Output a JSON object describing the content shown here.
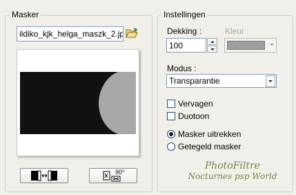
{
  "masker": {
    "title": "Masker",
    "filename": "ildiko_kjk_helga_maszk_2.jp",
    "invert_icon": "invert-mask-icon",
    "rotate_label": "90°"
  },
  "instellingen": {
    "title": "Instellingen",
    "dekking_label": "Dekking :",
    "dekking_value": "100",
    "kleur_label": "Kleur :",
    "kleur_swatch": "#a9a9a9",
    "modus_label": "Modus :",
    "modus_value": "Transparantie",
    "checkboxes": [
      {
        "label": "Vervagen",
        "checked": false
      },
      {
        "label": "Duotoon",
        "checked": false
      }
    ],
    "radios": [
      {
        "label": "Masker uitrekken",
        "selected": true
      },
      {
        "label": "Getegeld masker",
        "selected": false
      }
    ]
  },
  "watermark": {
    "line1": "PhotoFiltre",
    "line2": "Nocturnes psp World"
  }
}
